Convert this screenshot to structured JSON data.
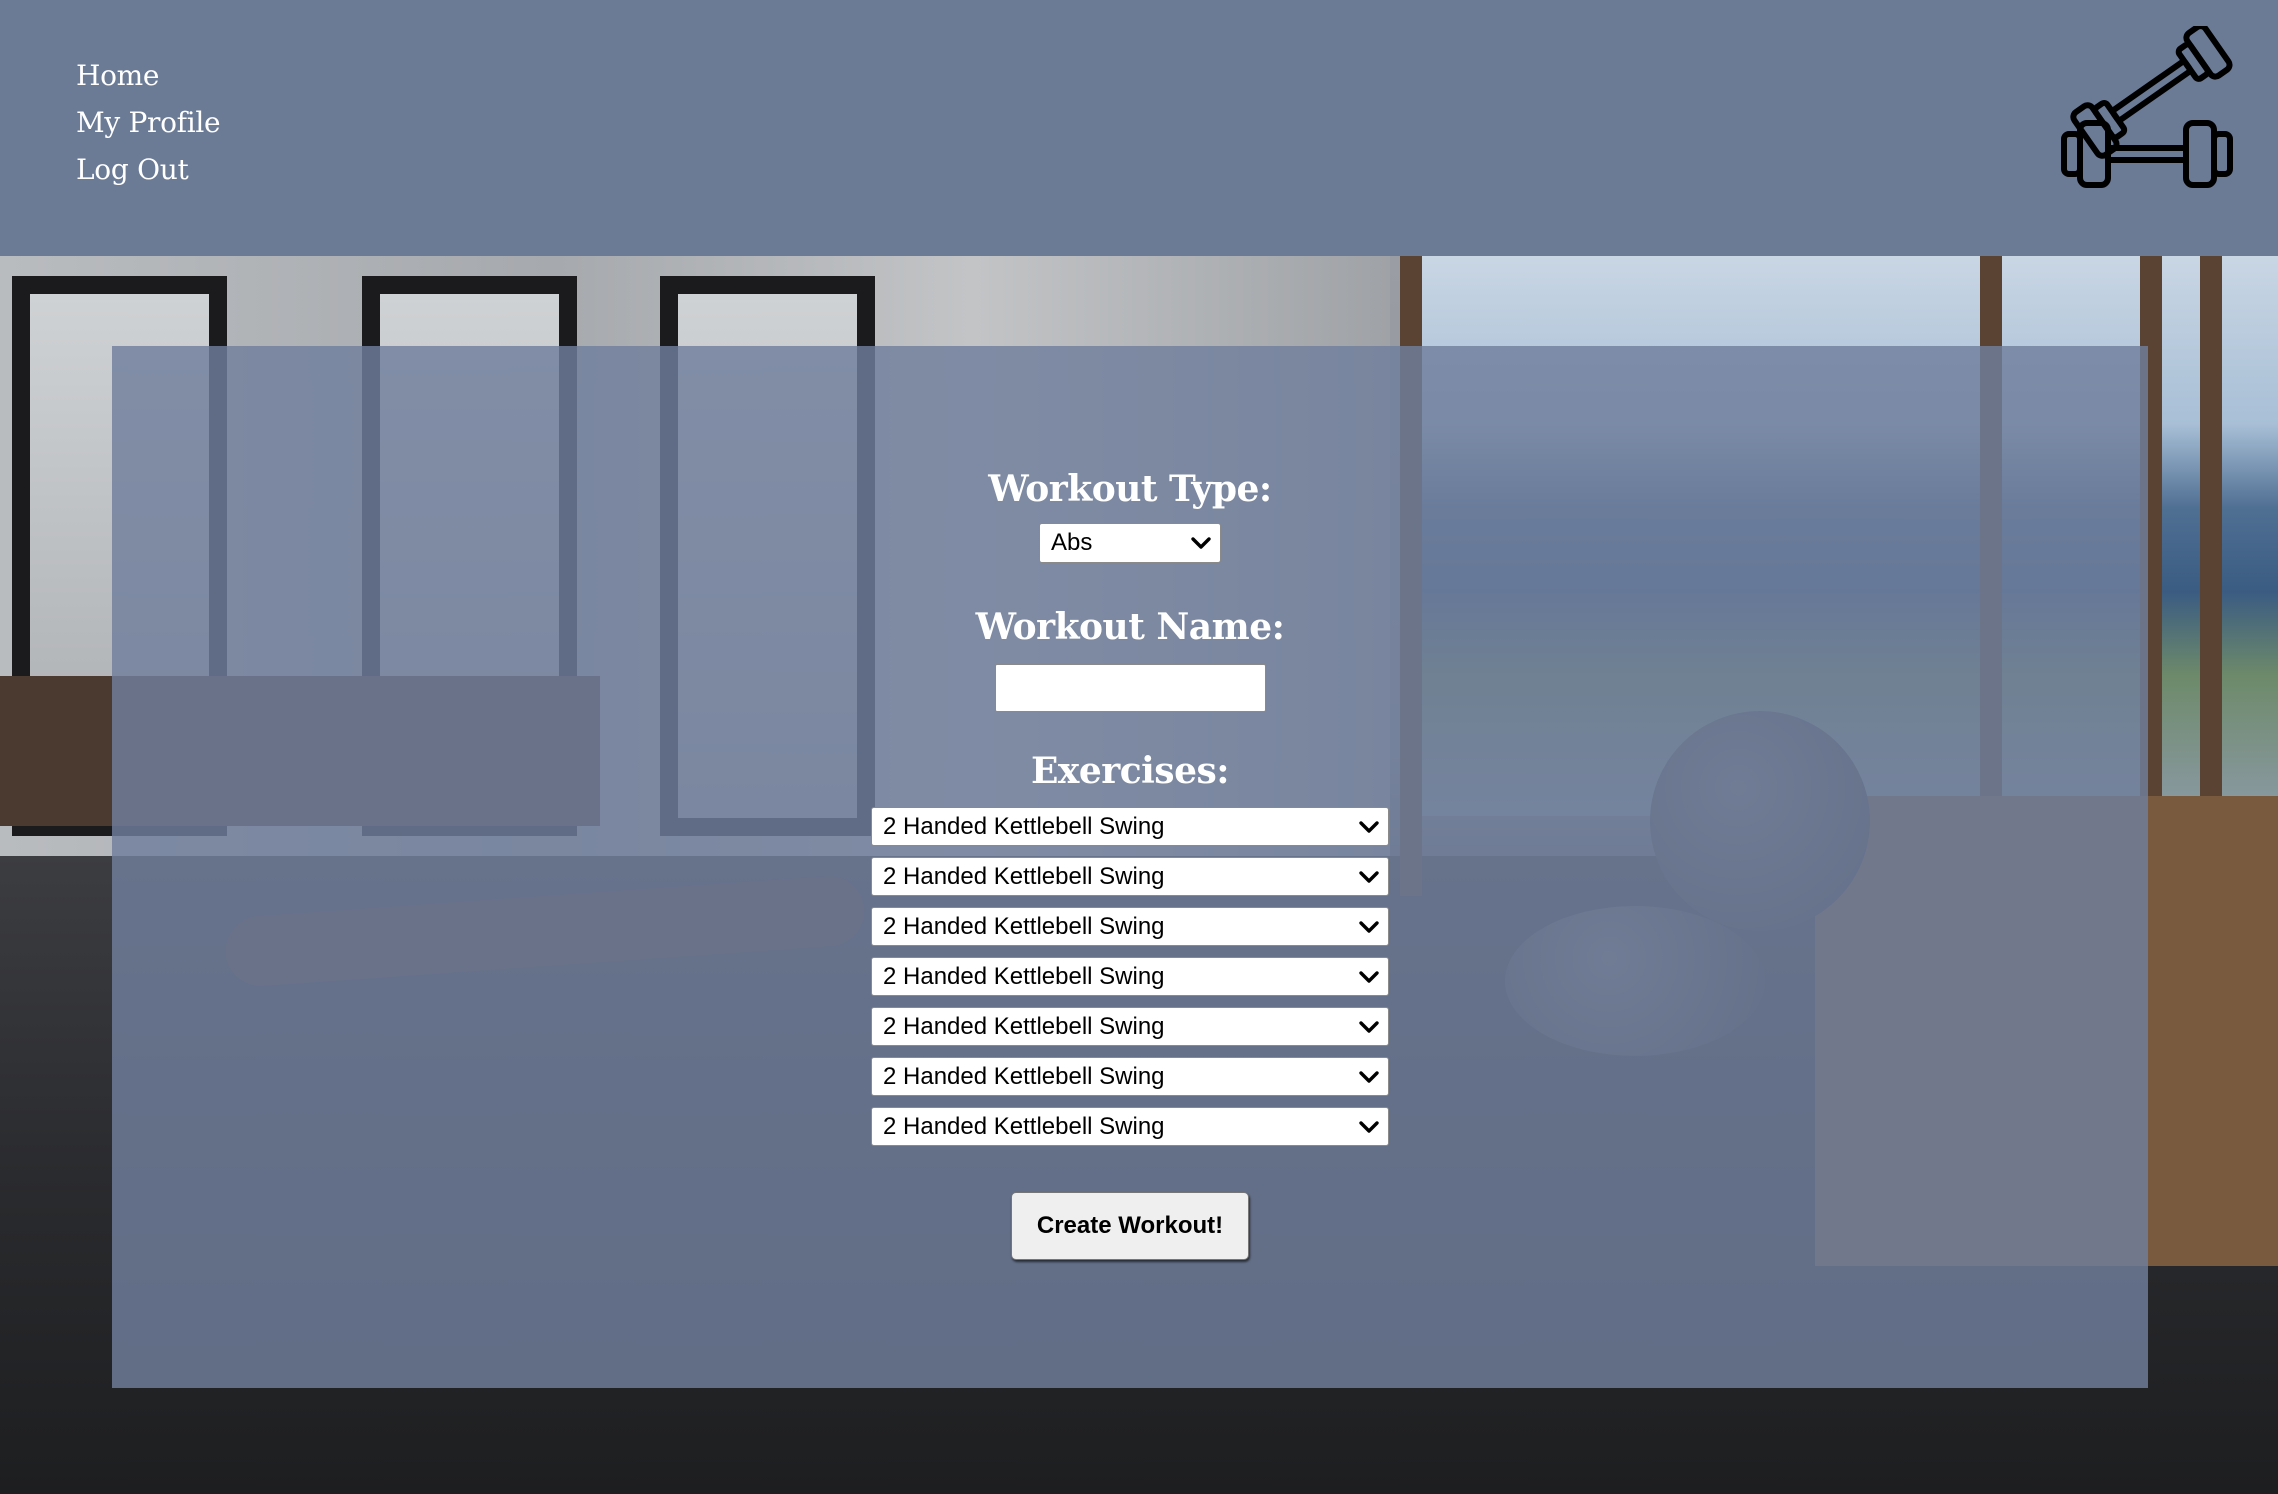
{
  "nav": {
    "items": [
      {
        "label": "Home"
      },
      {
        "label": "My Profile"
      },
      {
        "label": "Log Out"
      }
    ]
  },
  "logo": {
    "icon": "dumbbells-icon"
  },
  "form": {
    "workout_type_label": "Workout Type:",
    "workout_type_value": "Abs",
    "workout_name_label": "Workout Name:",
    "workout_name_value": "",
    "exercises_label": "Exercises:",
    "exercises": [
      "2 Handed Kettlebell Swing",
      "2 Handed Kettlebell Swing",
      "2 Handed Kettlebell Swing",
      "2 Handed Kettlebell Swing",
      "2 Handed Kettlebell Swing",
      "2 Handed Kettlebell Swing",
      "2 Handed Kettlebell Swing"
    ],
    "submit_label": "Create Workout!"
  },
  "colors": {
    "header_bg": "#6b7b96",
    "panel_bg": "#707f9c",
    "text": "#ffffff"
  }
}
